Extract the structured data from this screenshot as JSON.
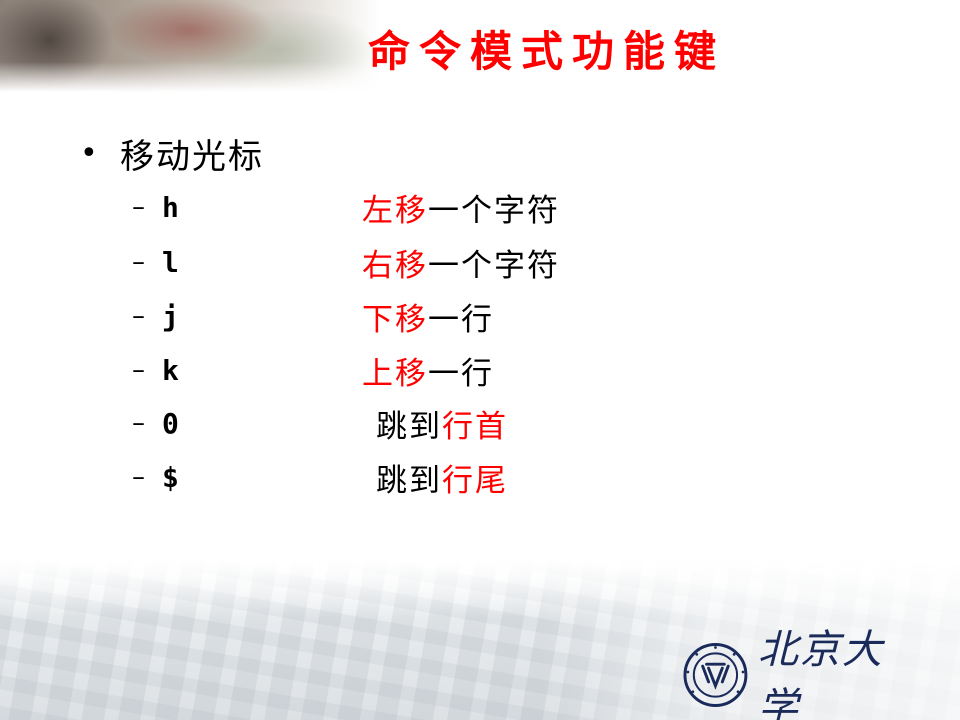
{
  "title": "命令模式功能键",
  "bullet": "移动光标",
  "items": [
    {
      "dash": "–",
      "key": "h",
      "desc_red": "左移",
      "desc_black": "一个字符",
      "red_first": true
    },
    {
      "dash": "–",
      "key": "l",
      "desc_red": "右移",
      "desc_black": "一个字符",
      "red_first": true
    },
    {
      "dash": "–",
      "key": "j",
      "desc_red": "下移",
      "desc_black": "一行",
      "red_first": true
    },
    {
      "dash": "–",
      "key": "k",
      "desc_red": "上移",
      "desc_black": "一行",
      "red_first": true
    },
    {
      "dash": "–",
      "key": "0",
      "desc_black": "跳到",
      "desc_red": "行首",
      "red_first": false
    },
    {
      "dash": "–",
      "key": "$",
      "desc_black": "跳到",
      "desc_red": "行尾",
      "red_first": false
    }
  ],
  "logo": {
    "text": "北京大学",
    "seal_text": "PEKING UNIVERSITY 1898"
  },
  "colors": {
    "title": "#ff0000",
    "highlight": "#ff0000",
    "logo": "#1a2a5a"
  }
}
